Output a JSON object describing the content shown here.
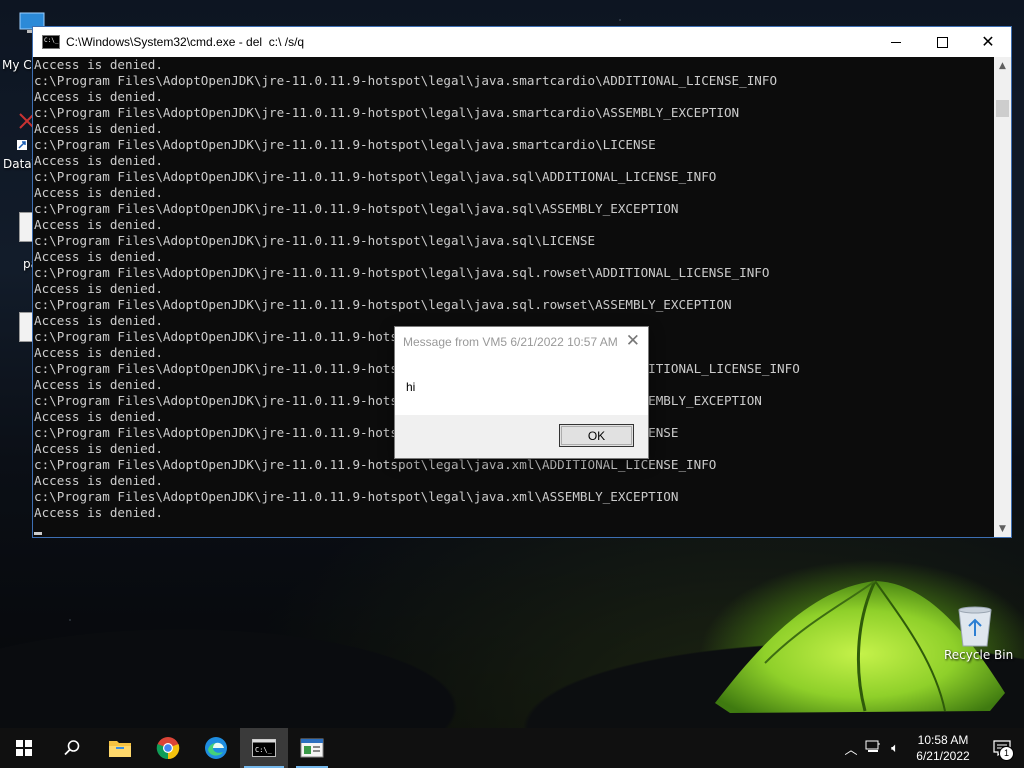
{
  "desktop": {
    "icons": [
      {
        "label": "My Co"
      },
      {
        "label": "DataV"
      },
      {
        "label": "pa"
      },
      {
        "label": ""
      },
      {
        "label": "Recycle Bin"
      }
    ]
  },
  "cmd_window": {
    "title": "C:\\Windows\\System32\\cmd.exe - del  c:\\ /s/q",
    "lines": [
      "Access is denied.",
      "c:\\Program Files\\AdoptOpenJDK\\jre-11.0.11.9-hotspot\\legal\\java.smartcardio\\ADDITIONAL_LICENSE_INFO",
      "Access is denied.",
      "c:\\Program Files\\AdoptOpenJDK\\jre-11.0.11.9-hotspot\\legal\\java.smartcardio\\ASSEMBLY_EXCEPTION",
      "Access is denied.",
      "c:\\Program Files\\AdoptOpenJDK\\jre-11.0.11.9-hotspot\\legal\\java.smartcardio\\LICENSE",
      "Access is denied.",
      "c:\\Program Files\\AdoptOpenJDK\\jre-11.0.11.9-hotspot\\legal\\java.sql\\ADDITIONAL_LICENSE_INFO",
      "Access is denied.",
      "c:\\Program Files\\AdoptOpenJDK\\jre-11.0.11.9-hotspot\\legal\\java.sql\\ASSEMBLY_EXCEPTION",
      "Access is denied.",
      "c:\\Program Files\\AdoptOpenJDK\\jre-11.0.11.9-hotspot\\legal\\java.sql\\LICENSE",
      "Access is denied.",
      "c:\\Program Files\\AdoptOpenJDK\\jre-11.0.11.9-hotspot\\legal\\java.sql.rowset\\ADDITIONAL_LICENSE_INFO",
      "Access is denied.",
      "c:\\Program Files\\AdoptOpenJDK\\jre-11.0.11.9-hotspot\\legal\\java.sql.rowset\\ASSEMBLY_EXCEPTION",
      "Access is denied.",
      "c:\\Program Files\\AdoptOpenJDK\\jre-11.0.11.9-hotspot\\legal\\java.sql.rowset\\LICENSE",
      "Access is denied.",
      "c:\\Program Files\\AdoptOpenJDK\\jre-11.0.11.9-hotspot\\legal\\java.transaction.xa\\ADDITIONAL_LICENSE_INFO",
      "Access is denied.",
      "c:\\Program Files\\AdoptOpenJDK\\jre-11.0.11.9-hotspot\\legal\\java.transaction.xa\\ASSEMBLY_EXCEPTION",
      "Access is denied.",
      "c:\\Program Files\\AdoptOpenJDK\\jre-11.0.11.9-hotspot\\legal\\java.transaction.xa\\LICENSE",
      "Access is denied.",
      "c:\\Program Files\\AdoptOpenJDK\\jre-11.0.11.9-hotspot\\legal\\java.xml\\ADDITIONAL_LICENSE_INFO",
      "Access is denied.",
      "c:\\Program Files\\AdoptOpenJDK\\jre-11.0.11.9-hotspot\\legal\\java.xml\\ASSEMBLY_EXCEPTION",
      "Access is denied."
    ]
  },
  "dialog": {
    "title": "Message from VM5 6/21/2022 10:57 AM",
    "message": "hi",
    "ok_label": "OK"
  },
  "taskbar": {
    "apps": [
      {
        "name": "start",
        "icon": "windows-logo-icon"
      },
      {
        "name": "search",
        "icon": "search-icon"
      },
      {
        "name": "file-explorer",
        "icon": "folder-icon"
      },
      {
        "name": "chrome",
        "icon": "chrome-icon"
      },
      {
        "name": "edge",
        "icon": "edge-icon"
      },
      {
        "name": "cmd",
        "icon": "cmd-icon"
      },
      {
        "name": "app",
        "icon": "window-app-icon"
      }
    ],
    "clock": {
      "time": "10:58 AM",
      "date": "6/21/2022"
    },
    "notification_count": "1"
  },
  "colors": {
    "console_bg": "#0c0c0c",
    "console_fg": "#cccccc",
    "taskbar_bg": "#101010",
    "accent": "#76b9ed",
    "tent_green": "#96d728"
  }
}
